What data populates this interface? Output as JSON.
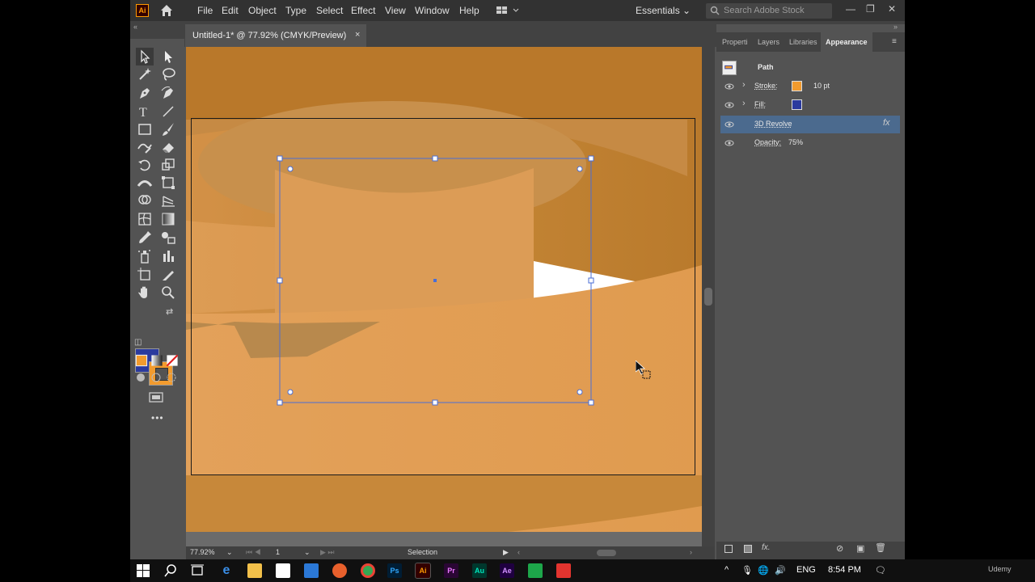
{
  "app": {
    "logo": "Ai",
    "icons": {
      "home": "home-icon",
      "workspace_switcher": "grid-icon",
      "search": "search-icon"
    }
  },
  "menu": [
    "File",
    "Edit",
    "Object",
    "Type",
    "Select",
    "Effect",
    "View",
    "Window",
    "Help"
  ],
  "workspace": {
    "label": "Essentials"
  },
  "stock_search": {
    "placeholder": "Search Adobe Stock"
  },
  "window_controls": {
    "minimize": "—",
    "restore": "❐",
    "close": "✕"
  },
  "document_tab": {
    "title": "Untitled-1* @ 77.92% (CMYK/Preview)",
    "close": "×"
  },
  "colors": {
    "fill": "#2b3a9e",
    "stroke": "#f29b2e",
    "artwork": "#e09a4e",
    "selection": "#4a6ed6"
  },
  "status_bar": {
    "zoom": "77.92%",
    "artboard_number": "1",
    "tool": "Selection"
  },
  "panel": {
    "tabs": [
      "Properti",
      "Layers",
      "Libraries",
      "Appearance"
    ],
    "active_tab": "Appearance",
    "object_type": "Path",
    "rows": [
      {
        "label": "Stroke:",
        "value": "10 pt",
        "swatch": "#f29b2e"
      },
      {
        "label": "Fill:",
        "value": "",
        "swatch": "#2b3a9e"
      },
      {
        "label": "3D Revolve",
        "value": "",
        "fx": "fx"
      },
      {
        "label": "Opacity:",
        "value": "75%"
      }
    ]
  },
  "taskbar": {
    "apps": [
      "windows-start-icon",
      "search-icon",
      "task-view-icon",
      "edge-icon",
      "file-explorer-icon",
      "store-icon",
      "mail-icon",
      "firefox-icon",
      "chrome-icon",
      "Ps",
      "Ai",
      "Pr",
      "Au",
      "Ae",
      "camtasia-icon",
      "acrobat-icon"
    ],
    "language": "ENG",
    "time": "8:54 PM"
  },
  "watermark": "Udemy"
}
